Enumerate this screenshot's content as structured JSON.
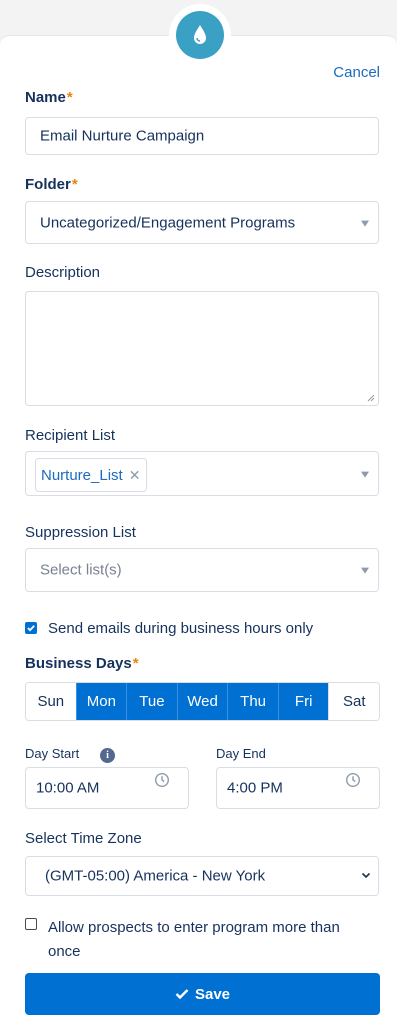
{
  "header": {
    "cancel_label": "Cancel",
    "badge_icon": "water-drop-icon",
    "badge_color": "#3aa0c4"
  },
  "name": {
    "label": "Name",
    "required_mark": "*",
    "value": "Email Nurture Campaign"
  },
  "folder": {
    "label": "Folder",
    "required_mark": "*",
    "value": "Uncategorized/Engagement Programs"
  },
  "description": {
    "label": "Description",
    "value": ""
  },
  "recipient_list": {
    "label": "Recipient List",
    "tags": [
      "Nurture_List"
    ],
    "remove_glyph": "✕"
  },
  "suppression_list": {
    "label": "Suppression List",
    "placeholder": "Select list(s)"
  },
  "business_hours": {
    "label": "Send emails during business hours only",
    "checked": true
  },
  "business_days": {
    "label": "Business Days",
    "required_mark": "*",
    "days": [
      {
        "label": "Sun",
        "selected": false
      },
      {
        "label": "Mon",
        "selected": true
      },
      {
        "label": "Tue",
        "selected": true
      },
      {
        "label": "Wed",
        "selected": true
      },
      {
        "label": "Thu",
        "selected": true
      },
      {
        "label": "Fri",
        "selected": true
      },
      {
        "label": "Sat",
        "selected": false
      }
    ]
  },
  "day_start": {
    "label": "Day Start",
    "info_glyph": "i",
    "value": "10:00 AM"
  },
  "day_end": {
    "label": "Day End",
    "value": "4:00 PM"
  },
  "time_zone": {
    "label": "Select Time Zone",
    "value": "(GMT-05:00) America - New York"
  },
  "allow_reentry": {
    "label_line1": "Allow prospects to enter program more than",
    "label_line2": "once",
    "checked": false
  },
  "save": {
    "label": "Save",
    "icon": "checkmark-icon"
  },
  "colors": {
    "accent": "#0070d2",
    "required": "#e8850b",
    "text": "#16325c",
    "link": "#1b6bbf"
  }
}
